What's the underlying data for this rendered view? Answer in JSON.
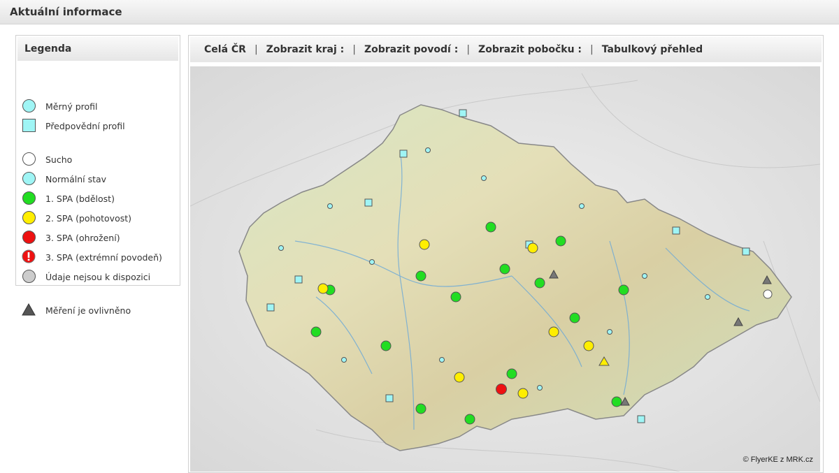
{
  "header": {
    "title": "Aktuální informace"
  },
  "legend": {
    "title": "Legenda",
    "items": [
      {
        "label": "Měrný profil",
        "symbol": "circle",
        "color": "#9ff5f5",
        "icon": "circle-icon"
      },
      {
        "label": "Předpovědní profil",
        "symbol": "square",
        "color": "#9ff5f5",
        "icon": "square-icon"
      },
      {
        "label": "Sucho",
        "symbol": "circle",
        "color": "#ffffff",
        "icon": "circle-icon"
      },
      {
        "label": "Normální stav",
        "symbol": "circle",
        "color": "#9ff5f5",
        "icon": "circle-icon"
      },
      {
        "label": "1. SPA (bdělost)",
        "symbol": "circle",
        "color": "#22dd22",
        "icon": "circle-icon"
      },
      {
        "label": "2. SPA (pohotovost)",
        "symbol": "circle",
        "color": "#ffee00",
        "icon": "circle-icon"
      },
      {
        "label": "3. SPA (ohrožení)",
        "symbol": "circle",
        "color": "#ee1111",
        "icon": "circle-icon"
      },
      {
        "label": "3. SPA (extrémní povodeň)",
        "symbol": "alert",
        "color": "#ee1111",
        "icon": "exclamation-icon"
      },
      {
        "label": "Údaje nejsou k dispozici",
        "symbol": "circle",
        "color": "#cccccc",
        "icon": "circle-icon"
      },
      {
        "label": "Měření je ovlivněno",
        "symbol": "triangle",
        "color": "#555555",
        "icon": "triangle-icon"
      }
    ]
  },
  "nav": {
    "links": [
      "Celá ČR",
      "Zobrazit kraj :",
      "Zobrazit povodí :",
      "Zobrazit pobočku :",
      "Tabulkový přehled"
    ],
    "separator": "|"
  },
  "map": {
    "credit": "© FlyerKE z MRK.cz",
    "colors": {
      "green": "#22dd22",
      "yellow": "#ffee00",
      "red": "#ee1111",
      "cyan": "#9ff5f5"
    }
  }
}
